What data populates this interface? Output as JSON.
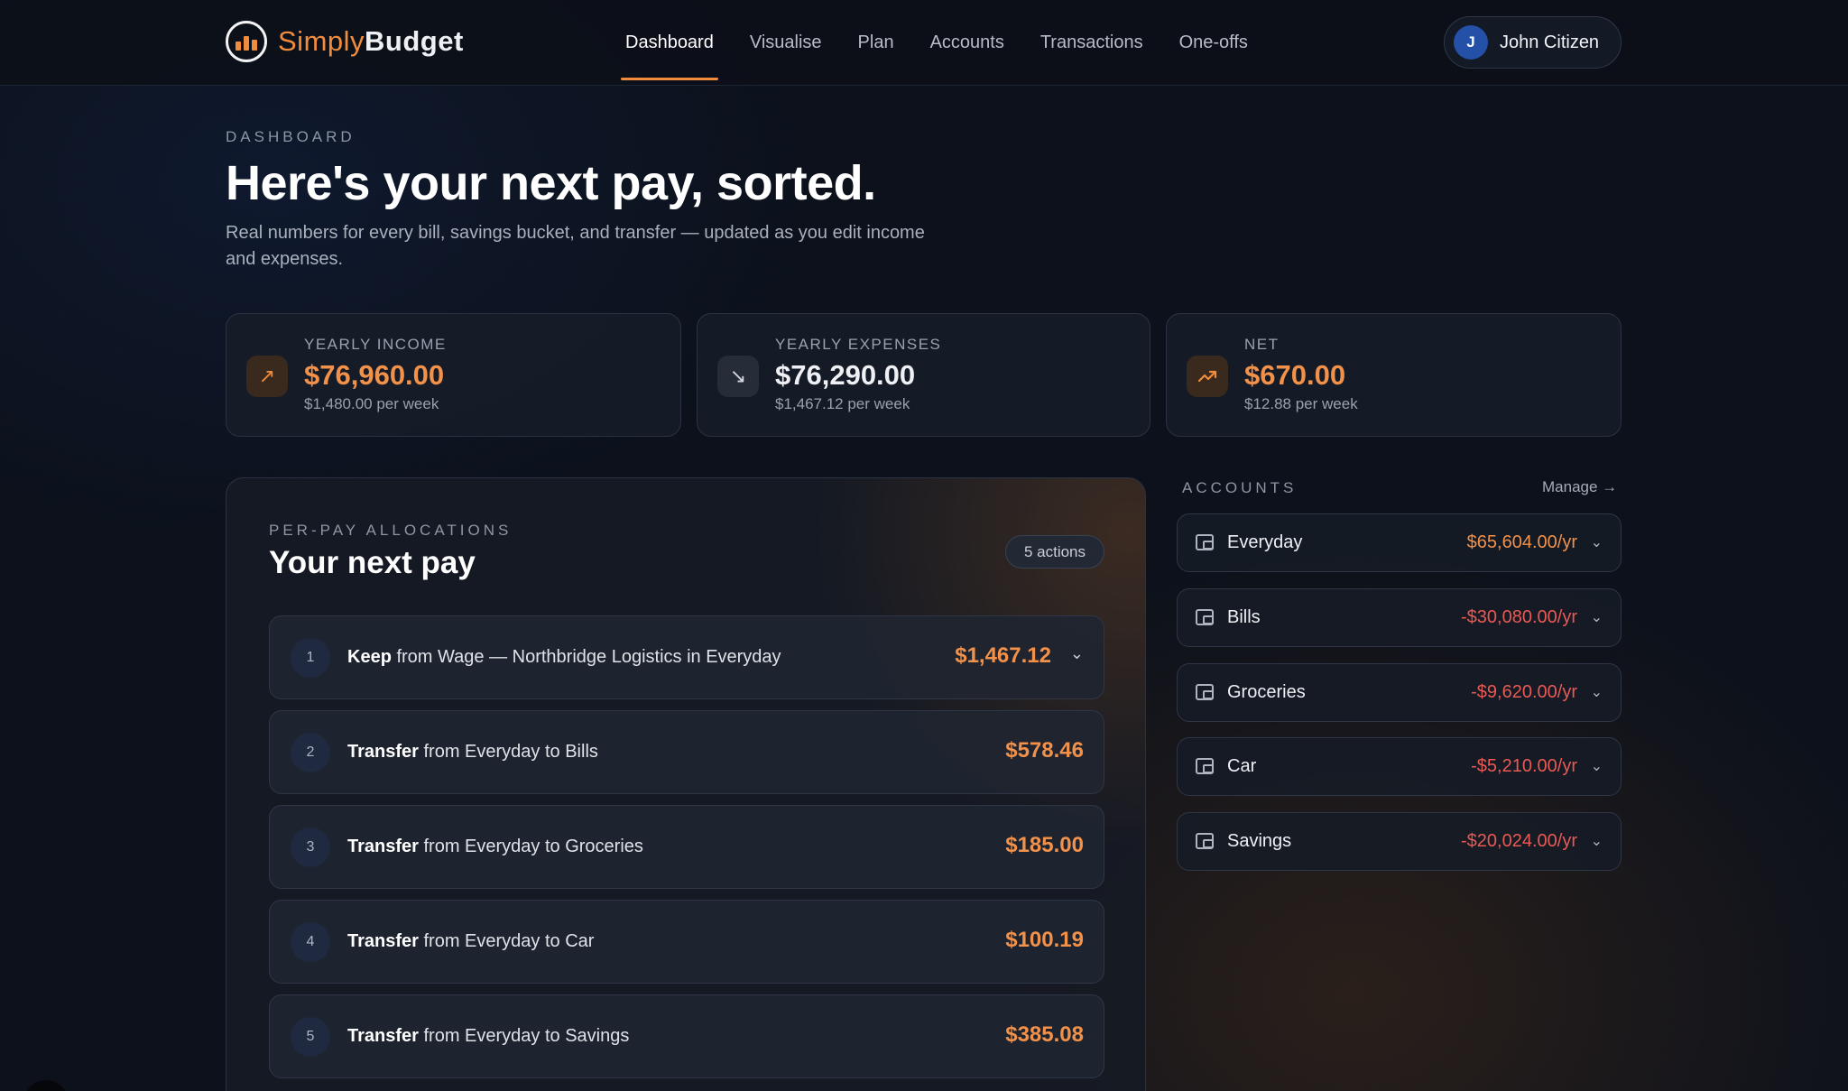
{
  "brand": {
    "name_part1": "Simply",
    "name_part2": "Budget"
  },
  "nav": {
    "items": [
      {
        "label": "Dashboard",
        "active": true
      },
      {
        "label": "Visualise",
        "active": false
      },
      {
        "label": "Plan",
        "active": false
      },
      {
        "label": "Accounts",
        "active": false
      },
      {
        "label": "Transactions",
        "active": false
      },
      {
        "label": "One-offs",
        "active": false
      }
    ]
  },
  "user": {
    "initial": "J",
    "name": "John Citizen"
  },
  "hero": {
    "eyebrow": "DASHBOARD",
    "title": "Here's your next pay, sorted.",
    "subtitle": "Real numbers for every bill, savings bucket, and transfer — updated as you edit income and expenses."
  },
  "stats": [
    {
      "label": "YEARLY INCOME",
      "value": "$76,960.00",
      "sub": "$1,480.00 per week",
      "icon": "arrow-up-right-icon"
    },
    {
      "label": "YEARLY EXPENSES",
      "value": "$76,290.00",
      "sub": "$1,467.12 per week",
      "icon": "arrow-down-right-icon"
    },
    {
      "label": "NET",
      "value": "$670.00",
      "sub": "$12.88 per week",
      "icon": "trending-up-icon"
    }
  ],
  "allocations": {
    "eyebrow": "PER-PAY ALLOCATIONS",
    "title": "Your next pay",
    "badge": "5 actions",
    "items": [
      {
        "num": "1",
        "verb": "Keep",
        "rest": " from Wage — Northbridge Logistics in Everyday",
        "amount": "$1,467.12"
      },
      {
        "num": "2",
        "verb": "Transfer",
        "rest": " from Everyday to Bills",
        "amount": "$578.46"
      },
      {
        "num": "3",
        "verb": "Transfer",
        "rest": " from Everyday to Groceries",
        "amount": "$185.00"
      },
      {
        "num": "4",
        "verb": "Transfer",
        "rest": " from Everyday to Car",
        "amount": "$100.19"
      },
      {
        "num": "5",
        "verb": "Transfer",
        "rest": " from Everyday to Savings",
        "amount": "$385.08"
      }
    ]
  },
  "accounts": {
    "eyebrow": "ACCOUNTS",
    "manage": "Manage →",
    "items": [
      {
        "name": "Everyday",
        "amount": "$65,604.00/yr"
      },
      {
        "name": "Bills",
        "amount": "-$30,080.00/yr"
      },
      {
        "name": "Groceries",
        "amount": "-$9,620.00/yr"
      },
      {
        "name": "Car",
        "amount": "-$5,210.00/yr"
      },
      {
        "name": "Savings",
        "amount": "-$20,024.00/yr"
      }
    ]
  },
  "colors": {
    "accent": "#f08c3c",
    "negative": "#ea5a55",
    "background": "#0c111b"
  }
}
